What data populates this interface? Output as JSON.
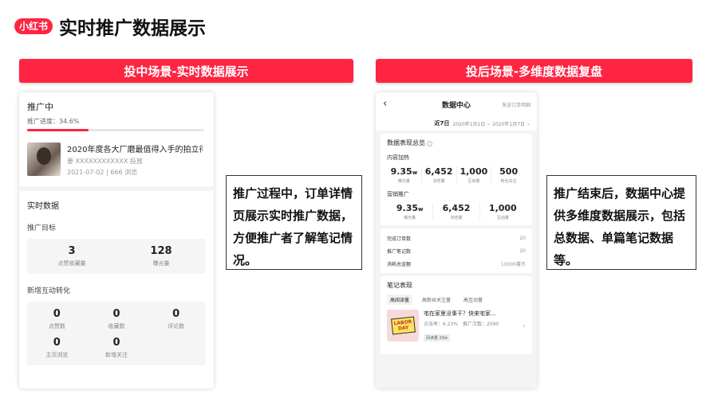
{
  "header": {
    "logo_text": "小红书",
    "title": "实时推广数据展示"
  },
  "banners": {
    "left": "投中场景-实时数据展示",
    "right": "投后场景-多维度数据复盘"
  },
  "left_phone": {
    "status": "推广中",
    "progress_label": "推广进度：34.6%",
    "progress": 0.346,
    "note": {
      "title": "2020年度各大厂磨最值得入手的拍立得...",
      "author": "要 XXXXXXXXXXXX 投放",
      "meta": "2021-07-02 | 666 浏览"
    },
    "realtime_title": "实时数据",
    "goal_title": "推广目标",
    "goal_stats": [
      {
        "value": "3",
        "label": "点赞收藏量"
      },
      {
        "value": "128",
        "label": "曝光量"
      }
    ],
    "interaction_title": "新增互动转化",
    "interaction_stats": [
      {
        "value": "0",
        "label": "点赞数"
      },
      {
        "value": "0",
        "label": "收藏数"
      },
      {
        "value": "0",
        "label": "评论数"
      },
      {
        "value": "0",
        "label": "主页浏览"
      },
      {
        "value": "0",
        "label": "新增关注"
      }
    ]
  },
  "callouts": {
    "left": "推广过程中，订单详情页展示实时推广数据，方便推广者了解笔记情况。",
    "right": "推广结束后，数据中心提供多维度数据展示，包括总数据、单篇笔记数据等。"
  },
  "right_phone": {
    "nav_title": "数据中心",
    "nav_right": "发送订单明细",
    "date_range_label": "近7日",
    "date_range": "2020年1月1日 ~ 2020年1月7日",
    "overview_title": "数据表现总览",
    "content_label": "内容加热",
    "content_stats": [
      {
        "value": "9.35",
        "unit": "w",
        "label": "曝光量"
      },
      {
        "value": "6,452",
        "unit": "",
        "label": "浏览量"
      },
      {
        "value": "1,000",
        "unit": "",
        "label": "互动量"
      },
      {
        "value": "500",
        "unit": "",
        "label": "粉丝关注"
      }
    ],
    "marketing_label": "营销推广",
    "marketing_stats": [
      {
        "value": "9.35",
        "unit": "w",
        "label": "曝光量"
      },
      {
        "value": "6,452",
        "unit": "",
        "label": "浏览量"
      },
      {
        "value": "1,000",
        "unit": "",
        "label": "互动量"
      }
    ],
    "orders": [
      {
        "label": "完成订单数",
        "value": "20"
      },
      {
        "label": "推广笔记数",
        "value": "20"
      },
      {
        "label": "消耗总金额",
        "value": "10000薯币"
      }
    ],
    "notes_title": "笔记表现",
    "tabs": [
      "高阅读量",
      "高粉丝关注量",
      "高互动量"
    ],
    "note": {
      "image_text_1": "LABOR",
      "image_text_2": "DAY",
      "title": "宅在家里没事干？快来宅家...",
      "meta": "点击率：6.23%　推广次数：2090",
      "tag": "阅读量 29w"
    }
  }
}
